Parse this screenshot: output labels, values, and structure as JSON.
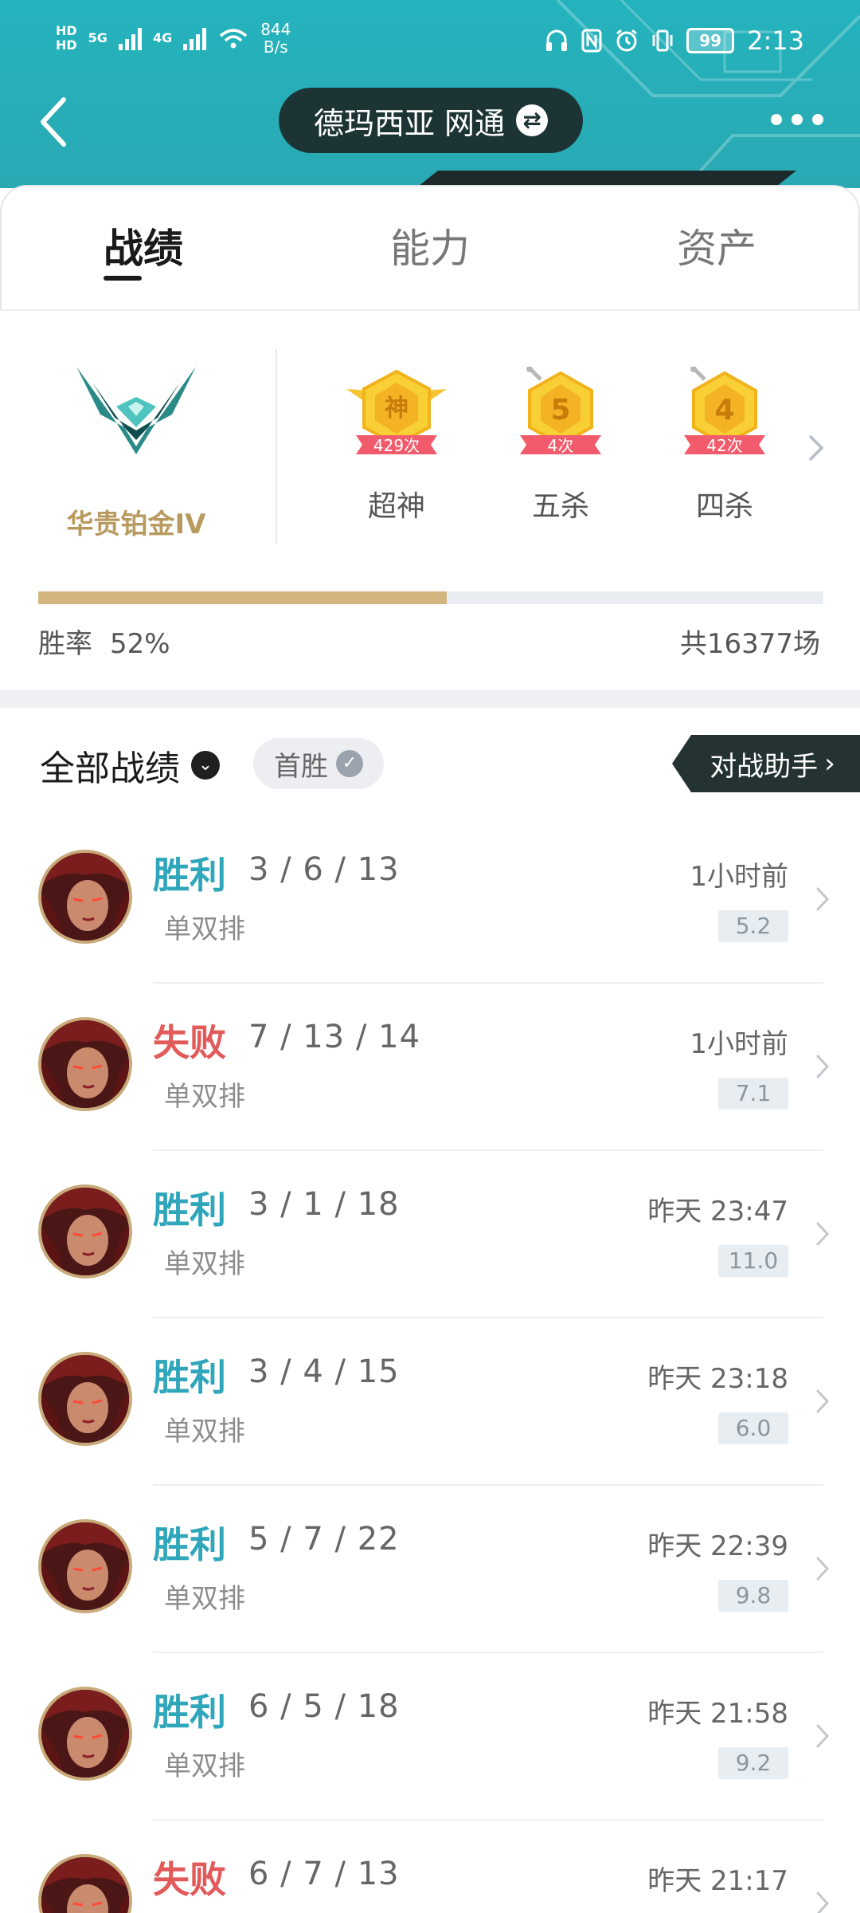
{
  "status_bar": {
    "network_a": "5G",
    "network_b": "4G",
    "speed_value": "844",
    "speed_unit": "B/s",
    "battery": "99",
    "time": "2:13"
  },
  "header": {
    "server": "德玛西亚 网通"
  },
  "tabs": [
    {
      "label": "战绩",
      "active": true
    },
    {
      "label": "能力",
      "active": false
    },
    {
      "label": "资产",
      "active": false
    }
  ],
  "rank": {
    "name": "华贵铂金IV"
  },
  "medals": [
    {
      "badge": "神",
      "count": "429次",
      "label": "超神"
    },
    {
      "badge": "5",
      "count": "4次",
      "label": "五杀"
    },
    {
      "badge": "4",
      "count": "42次",
      "label": "四杀"
    }
  ],
  "stats": {
    "winrate_label": "胜率",
    "winrate_value": "52%",
    "winrate_fraction": 0.52,
    "total": "共16377场"
  },
  "filters": {
    "all_label": "全部战绩",
    "chip_label": "首胜",
    "assistant_label": "对战助手"
  },
  "matches": [
    {
      "result": "胜利",
      "outcome": "win",
      "kda": "3 / 6 / 13",
      "mode": "单双排",
      "time": "1小时前",
      "score": "5.2"
    },
    {
      "result": "失败",
      "outcome": "lose",
      "kda": "7 / 13 / 14",
      "mode": "单双排",
      "time": "1小时前",
      "score": "7.1"
    },
    {
      "result": "胜利",
      "outcome": "win",
      "kda": "3 / 1 / 18",
      "mode": "单双排",
      "time": "昨天 23:47",
      "score": "11.0"
    },
    {
      "result": "胜利",
      "outcome": "win",
      "kda": "3 / 4 / 15",
      "mode": "单双排",
      "time": "昨天 23:18",
      "score": "6.0"
    },
    {
      "result": "胜利",
      "outcome": "win",
      "kda": "5 / 7 / 22",
      "mode": "单双排",
      "time": "昨天 22:39",
      "score": "9.8"
    },
    {
      "result": "胜利",
      "outcome": "win",
      "kda": "6 / 5 / 18",
      "mode": "单双排",
      "time": "昨天 21:58",
      "score": "9.2"
    },
    {
      "result": "失败",
      "outcome": "lose",
      "kda": "6 / 7 / 13",
      "mode": "",
      "time": "昨天 21:17",
      "score": ""
    }
  ],
  "colors": {
    "header_teal": "#24b3bd",
    "win": "#2fa6ba",
    "lose": "#e25a5a",
    "rank_gold": "#b89a5f",
    "winbar_fill": "#d2b57e"
  }
}
